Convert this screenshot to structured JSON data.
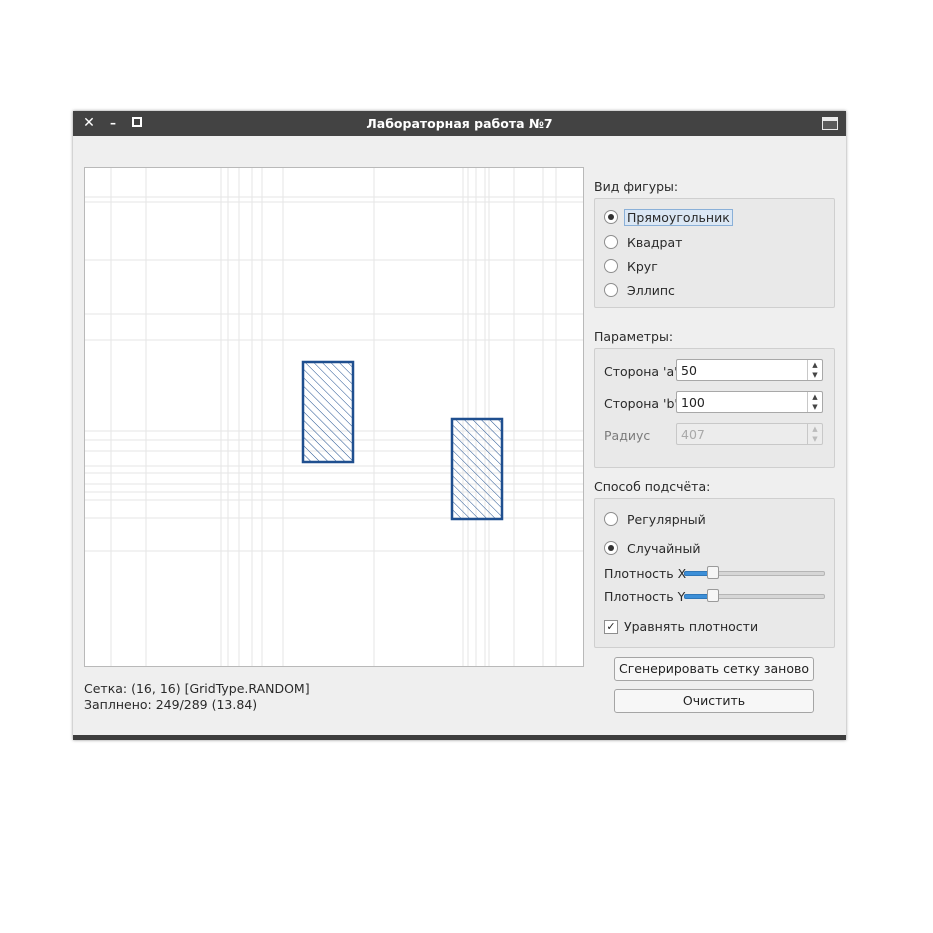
{
  "window": {
    "title": "Лабораторная работа №7",
    "close_glyph": "✕",
    "minimize_glyph": "–"
  },
  "canvas": {
    "hatch_color": "#1f4f8f",
    "grid_color": "#e6e6e6",
    "rectangle_count": 2
  },
  "status": {
    "grid": "Сетка: (16, 16) [GridType.RANDOM]",
    "filled": "Заплнено: 249/289 (13.84)"
  },
  "shape_group": {
    "title": "Вид фигуры:",
    "options": [
      {
        "label": "Прямоугольник",
        "checked": true
      },
      {
        "label": "Квадрат",
        "checked": false
      },
      {
        "label": "Круг",
        "checked": false
      },
      {
        "label": "Эллипс",
        "checked": false
      }
    ]
  },
  "params_group": {
    "title": "Параметры:",
    "side_a": {
      "label": "Сторона 'a'",
      "value": "50"
    },
    "side_b": {
      "label": "Сторона 'b'",
      "value": "100"
    },
    "radius": {
      "label": "Радиус",
      "value": "407",
      "disabled": true
    }
  },
  "method_group": {
    "title": "Способ подсчёта:",
    "regular_label": "Регулярный",
    "random_label": "Случайный",
    "selected": "random",
    "density_x": {
      "label": "Плотность X",
      "value": 0.18
    },
    "density_y": {
      "label": "Плотность Y",
      "value": 0.18
    },
    "equalize": {
      "label": "Уравнять плотности",
      "checked": true,
      "check_glyph": "✓"
    }
  },
  "buttons": {
    "regenerate": "Сгенерировать сетку заново",
    "clear": "Очистить"
  },
  "colors": {
    "accent": "#3c8fd8",
    "titlebar": "#434343"
  }
}
